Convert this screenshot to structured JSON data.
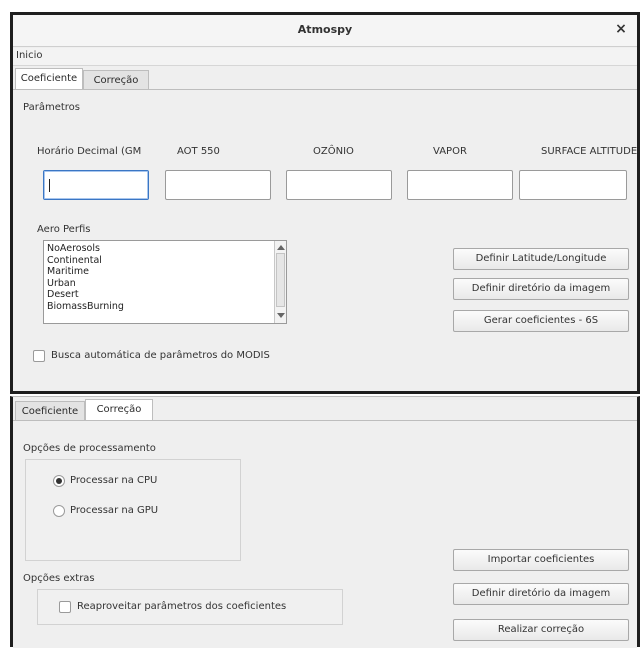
{
  "window": {
    "title": "Atmospy",
    "close_glyph": "×"
  },
  "menu": {
    "items": [
      "Inicio"
    ]
  },
  "top_tabs": [
    "Coeficiente",
    "Correção"
  ],
  "coef": {
    "group_title": "Parâmetros",
    "param_labels": [
      "Horário Decimal (GMT",
      "AOT 550",
      "OZÔNIO",
      "VAPOR",
      "SURFACE ALTITUDE"
    ],
    "param_values": [
      "",
      "",
      "",
      "",
      ""
    ],
    "aero_label": "Aero Perfis",
    "aero_profiles": [
      "NoAerosols",
      "Continental",
      "Maritime",
      "Urban",
      "Desert",
      "BiomassBurning"
    ],
    "buttons": [
      "Definir Latitude/Longitude",
      "Definir diretório da imagem",
      "Gerar coeficientes - 6S"
    ],
    "modis_checkbox": {
      "label": "Busca automática de parâmetros do MODIS",
      "checked": false
    }
  },
  "bottom_tabs": [
    "Coeficiente",
    "Correção"
  ],
  "corr": {
    "processing_title": "Opções de processamento",
    "radios": [
      {
        "label": "Processar na CPU",
        "selected": true
      },
      {
        "label": "Processar na GPU",
        "selected": false
      }
    ],
    "extras_title": "Opções extras",
    "reuse_checkbox": {
      "label": "Reaproveitar parâmetros dos coeficientes",
      "checked": false
    },
    "buttons": [
      "Importar coeficientes",
      "Definir diretório da imagem",
      "Realizar correção"
    ]
  }
}
